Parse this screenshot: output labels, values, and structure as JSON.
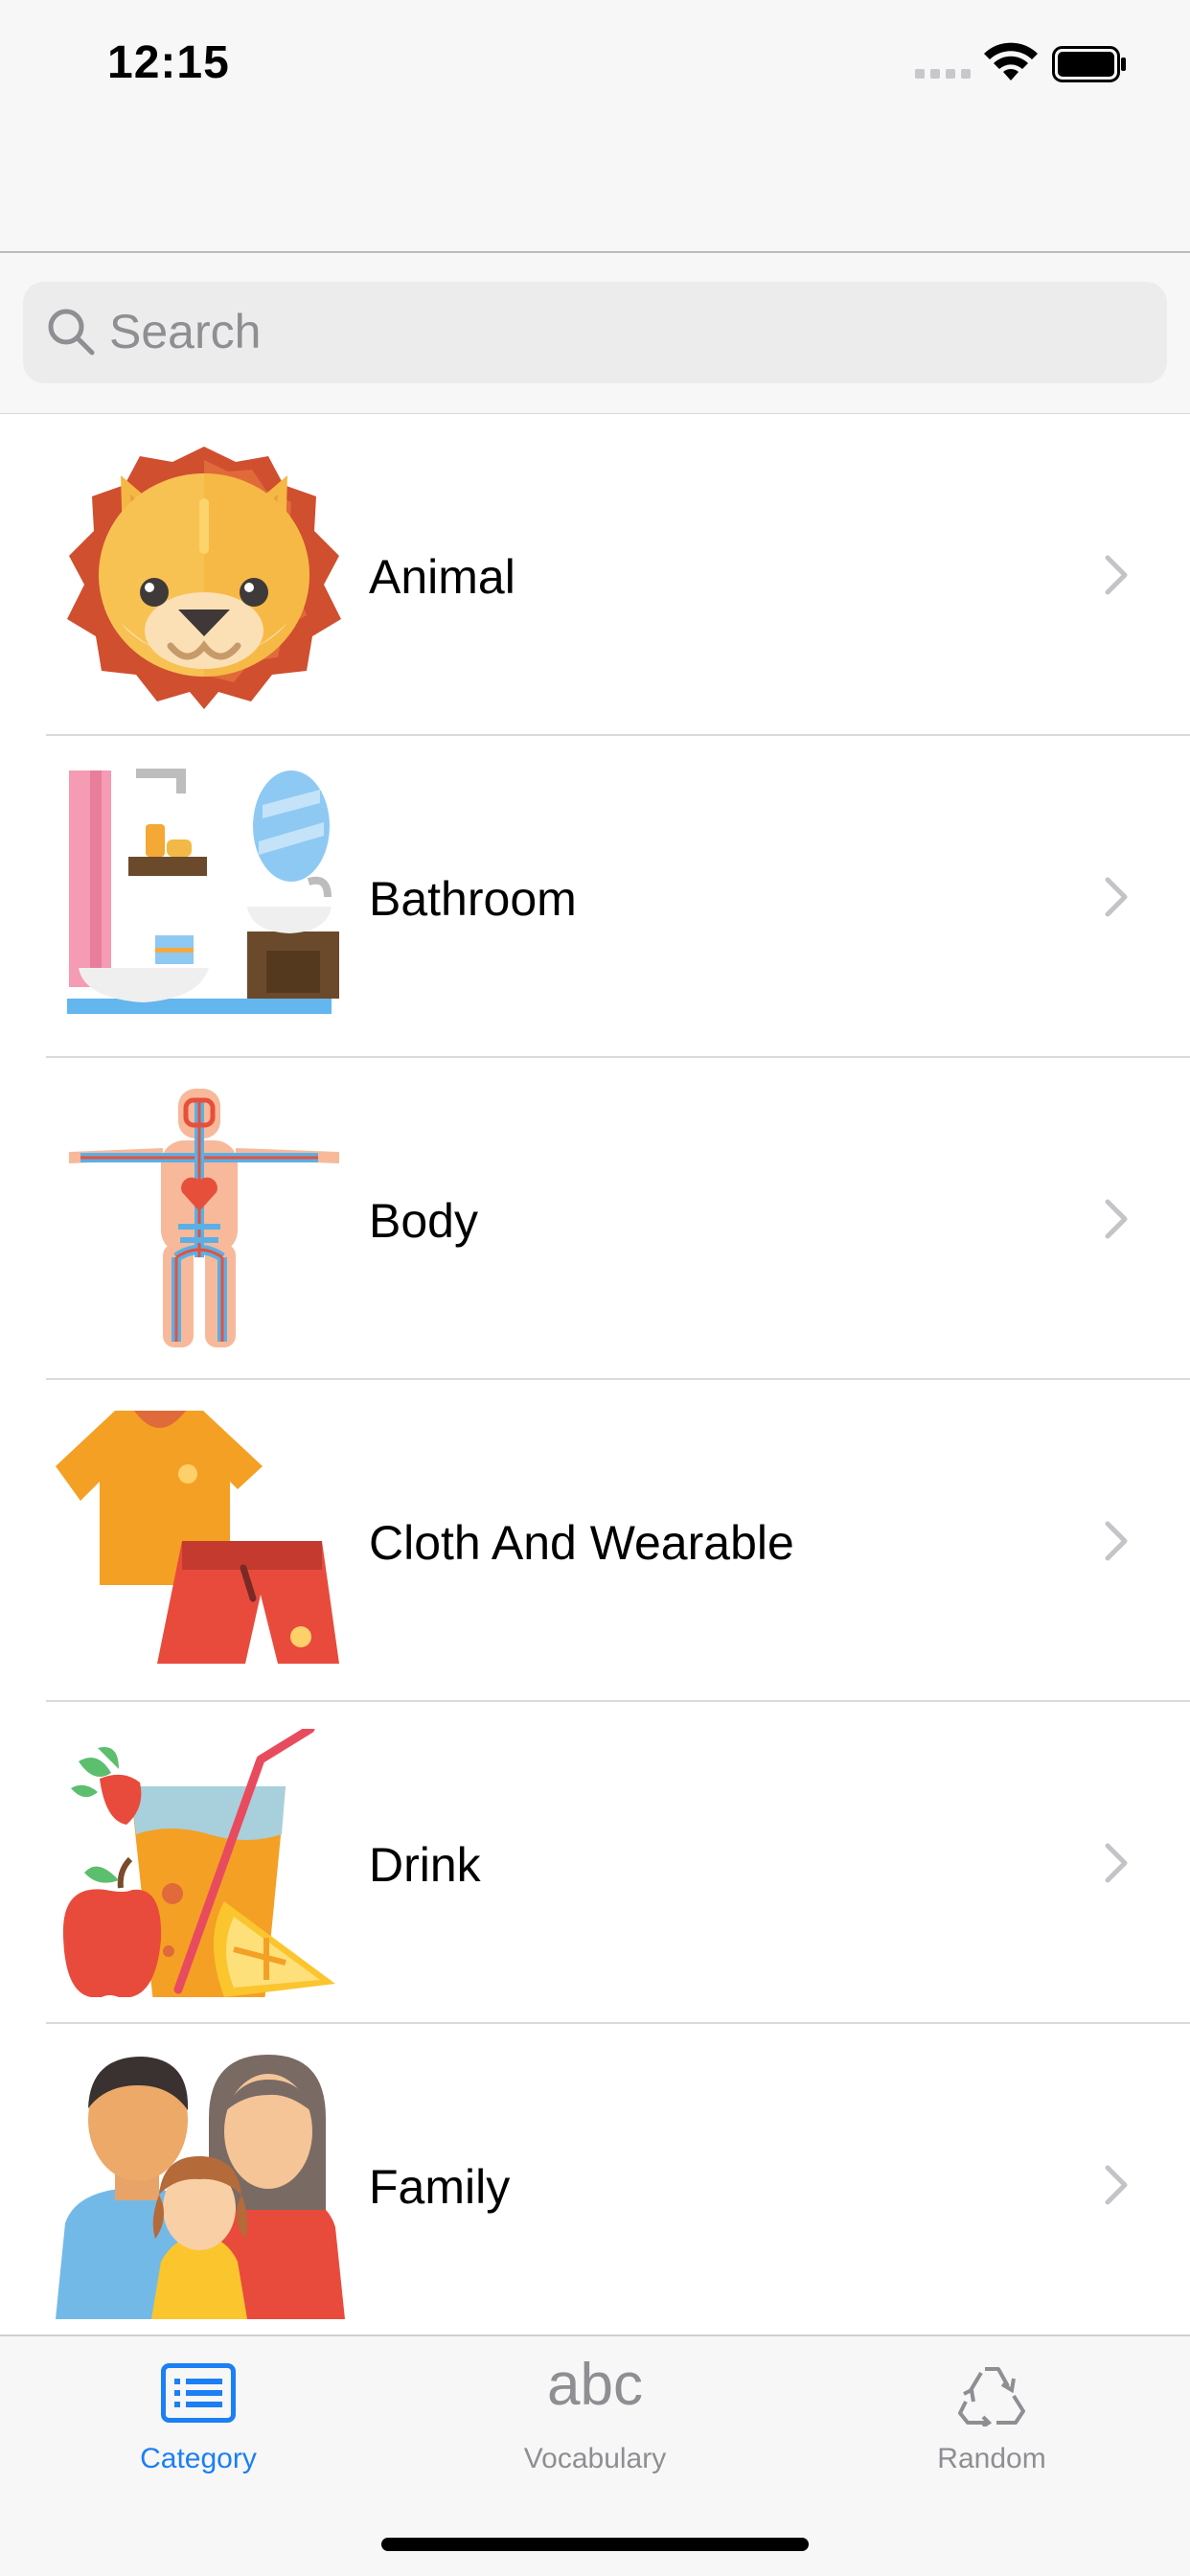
{
  "status_bar": {
    "time": "12:15"
  },
  "search": {
    "placeholder": "Search"
  },
  "categories": [
    {
      "label": "Animal",
      "icon": "lion-icon"
    },
    {
      "label": "Bathroom",
      "icon": "bathroom-icon"
    },
    {
      "label": "Body",
      "icon": "human-body-icon"
    },
    {
      "label": "Cloth And Wearable",
      "icon": "clothes-icon"
    },
    {
      "label": "Drink",
      "icon": "juice-icon"
    },
    {
      "label": "Family",
      "icon": "family-icon"
    }
  ],
  "tabs": [
    {
      "label": "Category",
      "icon": "list-icon",
      "active": true
    },
    {
      "label": "Vocabulary",
      "icon": "abc-icon",
      "glyph": "abc",
      "active": false
    },
    {
      "label": "Random",
      "icon": "recycle-icon",
      "active": false
    }
  ],
  "colors": {
    "accent": "#1b7ff5",
    "inactive": "#8e8e93"
  }
}
